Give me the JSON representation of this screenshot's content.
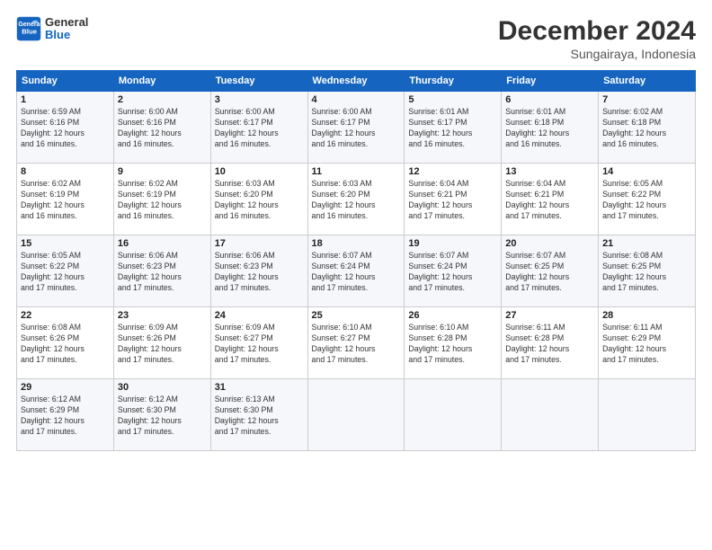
{
  "logo": {
    "line1": "General",
    "line2": "Blue"
  },
  "title": "December 2024",
  "subtitle": "Sungairaya, Indonesia",
  "days_of_week": [
    "Sunday",
    "Monday",
    "Tuesday",
    "Wednesday",
    "Thursday",
    "Friday",
    "Saturday"
  ],
  "weeks": [
    [
      {
        "day": 1,
        "sunrise": "6:59 AM",
        "sunset": "6:16 PM",
        "daylight": "12 hours and 16 minutes."
      },
      {
        "day": 2,
        "sunrise": "6:00 AM",
        "sunset": "6:16 PM",
        "daylight": "12 hours and 16 minutes."
      },
      {
        "day": 3,
        "sunrise": "6:00 AM",
        "sunset": "6:17 PM",
        "daylight": "12 hours and 16 minutes."
      },
      {
        "day": 4,
        "sunrise": "6:00 AM",
        "sunset": "6:17 PM",
        "daylight": "12 hours and 16 minutes."
      },
      {
        "day": 5,
        "sunrise": "6:01 AM",
        "sunset": "6:17 PM",
        "daylight": "12 hours and 16 minutes."
      },
      {
        "day": 6,
        "sunrise": "6:01 AM",
        "sunset": "6:18 PM",
        "daylight": "12 hours and 16 minutes."
      },
      {
        "day": 7,
        "sunrise": "6:02 AM",
        "sunset": "6:18 PM",
        "daylight": "12 hours and 16 minutes."
      }
    ],
    [
      {
        "day": 8,
        "sunrise": "6:02 AM",
        "sunset": "6:19 PM",
        "daylight": "12 hours and 16 minutes."
      },
      {
        "day": 9,
        "sunrise": "6:02 AM",
        "sunset": "6:19 PM",
        "daylight": "12 hours and 16 minutes."
      },
      {
        "day": 10,
        "sunrise": "6:03 AM",
        "sunset": "6:20 PM",
        "daylight": "12 hours and 16 minutes."
      },
      {
        "day": 11,
        "sunrise": "6:03 AM",
        "sunset": "6:20 PM",
        "daylight": "12 hours and 16 minutes."
      },
      {
        "day": 12,
        "sunrise": "6:04 AM",
        "sunset": "6:21 PM",
        "daylight": "12 hours and 17 minutes."
      },
      {
        "day": 13,
        "sunrise": "6:04 AM",
        "sunset": "6:21 PM",
        "daylight": "12 hours and 17 minutes."
      },
      {
        "day": 14,
        "sunrise": "6:05 AM",
        "sunset": "6:22 PM",
        "daylight": "12 hours and 17 minutes."
      }
    ],
    [
      {
        "day": 15,
        "sunrise": "6:05 AM",
        "sunset": "6:22 PM",
        "daylight": "12 hours and 17 minutes."
      },
      {
        "day": 16,
        "sunrise": "6:06 AM",
        "sunset": "6:23 PM",
        "daylight": "12 hours and 17 minutes."
      },
      {
        "day": 17,
        "sunrise": "6:06 AM",
        "sunset": "6:23 PM",
        "daylight": "12 hours and 17 minutes."
      },
      {
        "day": 18,
        "sunrise": "6:07 AM",
        "sunset": "6:24 PM",
        "daylight": "12 hours and 17 minutes."
      },
      {
        "day": 19,
        "sunrise": "6:07 AM",
        "sunset": "6:24 PM",
        "daylight": "12 hours and 17 minutes."
      },
      {
        "day": 20,
        "sunrise": "6:07 AM",
        "sunset": "6:25 PM",
        "daylight": "12 hours and 17 minutes."
      },
      {
        "day": 21,
        "sunrise": "6:08 AM",
        "sunset": "6:25 PM",
        "daylight": "12 hours and 17 minutes."
      }
    ],
    [
      {
        "day": 22,
        "sunrise": "6:08 AM",
        "sunset": "6:26 PM",
        "daylight": "12 hours and 17 minutes."
      },
      {
        "day": 23,
        "sunrise": "6:09 AM",
        "sunset": "6:26 PM",
        "daylight": "12 hours and 17 minutes."
      },
      {
        "day": 24,
        "sunrise": "6:09 AM",
        "sunset": "6:27 PM",
        "daylight": "12 hours and 17 minutes."
      },
      {
        "day": 25,
        "sunrise": "6:10 AM",
        "sunset": "6:27 PM",
        "daylight": "12 hours and 17 minutes."
      },
      {
        "day": 26,
        "sunrise": "6:10 AM",
        "sunset": "6:28 PM",
        "daylight": "12 hours and 17 minutes."
      },
      {
        "day": 27,
        "sunrise": "6:11 AM",
        "sunset": "6:28 PM",
        "daylight": "12 hours and 17 minutes."
      },
      {
        "day": 28,
        "sunrise": "6:11 AM",
        "sunset": "6:29 PM",
        "daylight": "12 hours and 17 minutes."
      }
    ],
    [
      {
        "day": 29,
        "sunrise": "6:12 AM",
        "sunset": "6:29 PM",
        "daylight": "12 hours and 17 minutes."
      },
      {
        "day": 30,
        "sunrise": "6:12 AM",
        "sunset": "6:30 PM",
        "daylight": "12 hours and 17 minutes."
      },
      {
        "day": 31,
        "sunrise": "6:13 AM",
        "sunset": "6:30 PM",
        "daylight": "12 hours and 17 minutes."
      },
      null,
      null,
      null,
      null
    ]
  ],
  "labels": {
    "sunrise": "Sunrise:",
    "sunset": "Sunset:",
    "daylight": "Daylight:"
  }
}
